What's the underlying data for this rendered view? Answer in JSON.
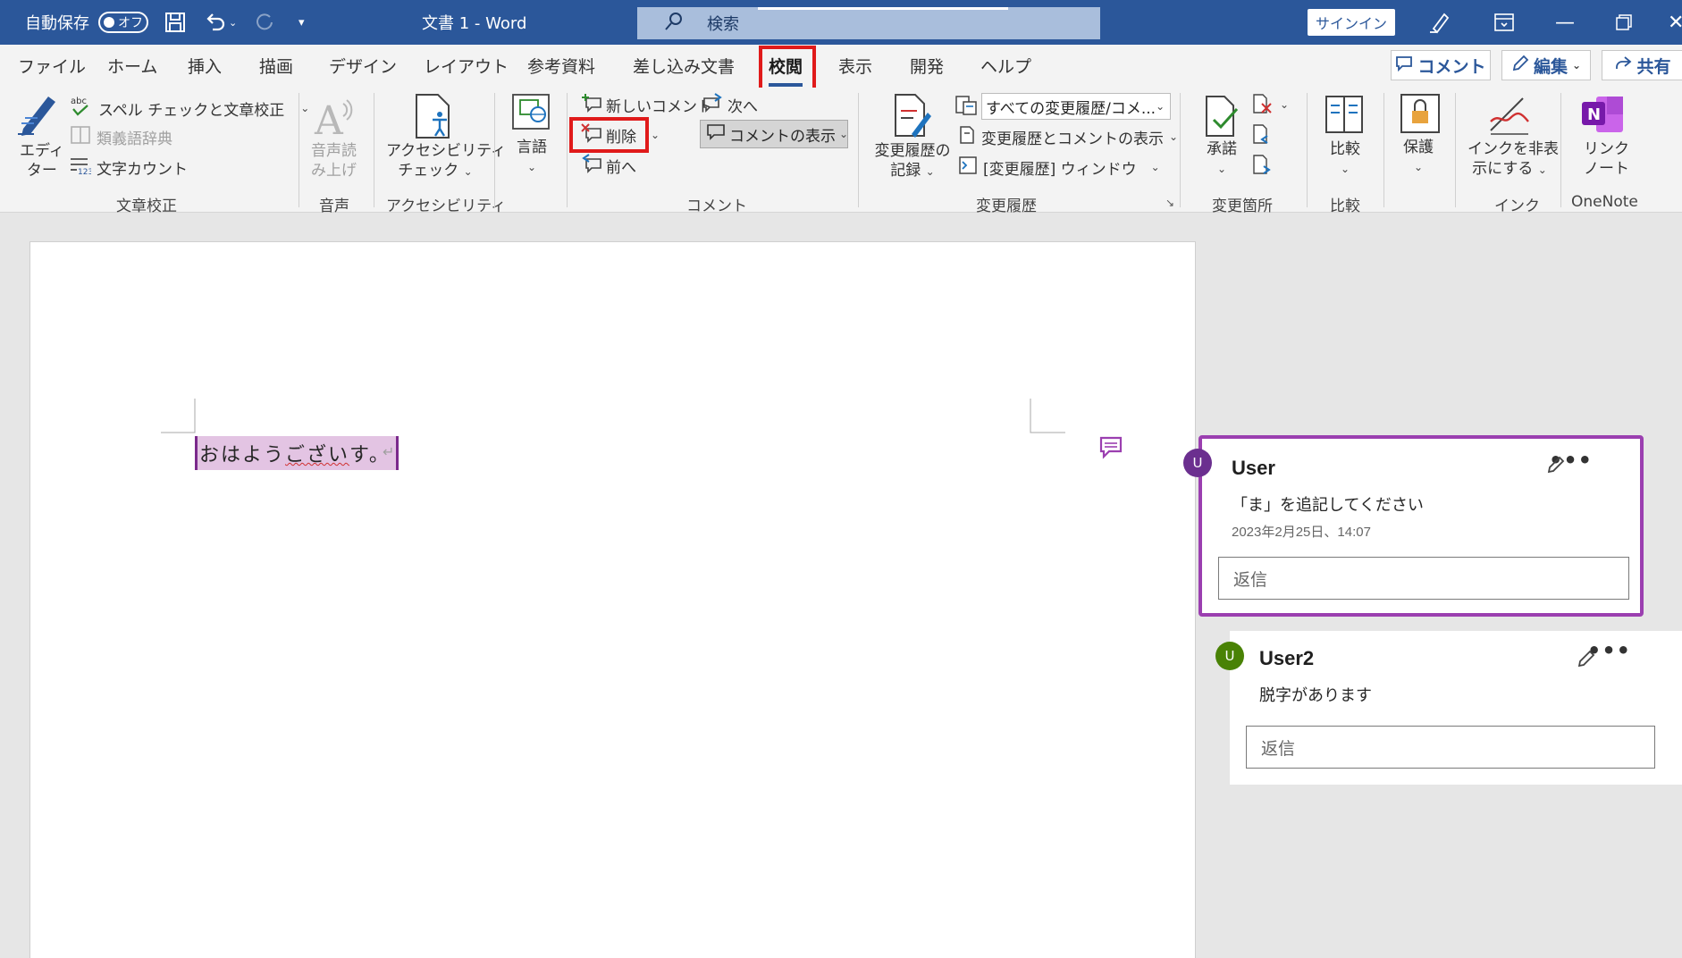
{
  "titlebar": {
    "autosave_label": "自動保存",
    "autosave_state": "オフ",
    "doc_title": "文書 1  -  Word",
    "search_placeholder": "検索",
    "signin": "サインイン"
  },
  "tabs": [
    "ファイル",
    "ホーム",
    "挿入",
    "描画",
    "デザイン",
    "レイアウト",
    "参考資料",
    "差し込み文書",
    "校閲",
    "表示",
    "開発",
    "ヘルプ"
  ],
  "active_tab": "校閲",
  "top_buttons": {
    "comment": "コメント",
    "edit": "編集",
    "share": "共有"
  },
  "ribbon": {
    "proofing": {
      "editor": [
        "エディ",
        "ター"
      ],
      "spell": "スペル チェックと文章校正",
      "thesaurus": "類義語辞典",
      "wordcount": "文字カウント",
      "group": "文章校正"
    },
    "speech": {
      "readaloud": [
        "音声読",
        "み上げ"
      ],
      "group": "音声"
    },
    "accessibility": {
      "check": [
        "アクセシビリティ",
        "チェック"
      ],
      "group": "アクセシビリティ"
    },
    "language": {
      "label": "言語"
    },
    "comments": {
      "new": "新しいコメント",
      "delete": "削除",
      "prev": "前へ",
      "next": "次へ",
      "show": "コメントの表示",
      "group": "コメント"
    },
    "tracking": {
      "track": [
        "変更履歴の",
        "記録"
      ],
      "markup_combo": "すべての変更履歴/コメ...",
      "show_markup": "変更履歴とコメントの表示",
      "pane": "[変更履歴] ウィンドウ",
      "group": "変更履歴"
    },
    "changes": {
      "accept": "承諾",
      "group": "変更箇所"
    },
    "compare": {
      "label": "比較",
      "group": "比較"
    },
    "protect": {
      "label": "保護"
    },
    "ink": {
      "hide": [
        "インクを非表",
        "示にする"
      ],
      "group": "インク"
    },
    "onenote": {
      "link": [
        "リンク",
        "ノート"
      ],
      "group": "OneNote"
    }
  },
  "document": {
    "text_before": "おはよう",
    "text_squiggle": "ござい",
    "text_after": "す。"
  },
  "comments": [
    {
      "initial": "U",
      "author": "User",
      "text": "「ま」を追記してください",
      "date": "2023年2月25日、14:07",
      "reply_placeholder": "返信",
      "color": "#6b2f8f"
    },
    {
      "initial": "U",
      "author": "User2",
      "text": "脱字があります",
      "reply_placeholder": "返信",
      "color": "#498205"
    }
  ],
  "colors": {
    "word_blue": "#2b579a",
    "highlight": "#e01a1a",
    "active_comment": "#9b3fb0"
  }
}
